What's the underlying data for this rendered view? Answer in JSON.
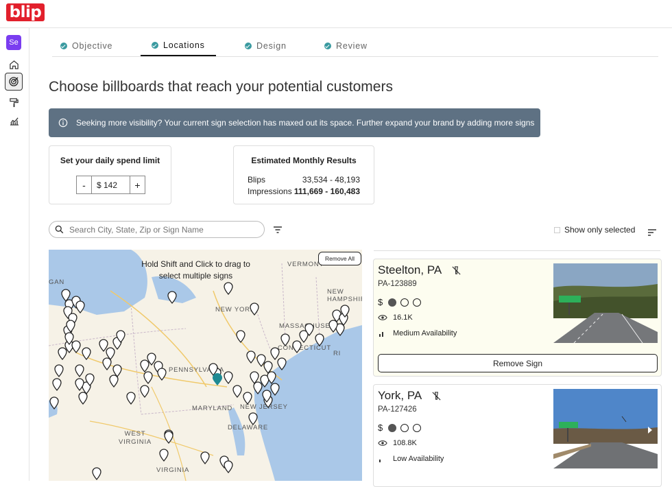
{
  "app": {
    "logo_text": "blip",
    "avatar_initials": "Se",
    "brand_color": "#e2202c"
  },
  "nav": [
    {
      "name": "home-icon"
    },
    {
      "name": "target-icon",
      "active": true
    },
    {
      "name": "paint-roller-icon"
    },
    {
      "name": "analytics-icon"
    }
  ],
  "tabs": [
    {
      "label": "Objective",
      "done": true
    },
    {
      "label": "Locations",
      "done": true,
      "active": true
    },
    {
      "label": "Design",
      "done": true
    },
    {
      "label": "Review",
      "done": true
    }
  ],
  "page_title": "Choose billboards that reach your potential customers",
  "info_banner": "Seeking more visibility? Your current sign selection has maxed out its space. Further expand your brand by adding more signs",
  "spend": {
    "title": "Set your daily spend limit",
    "minus": "-",
    "plus": "+",
    "value": "$ 142"
  },
  "results": {
    "title": "Estimated Monthly Results",
    "blips_label": "Blips",
    "blips_value": "33,534 - 48,193",
    "impressions_label": "Impressions",
    "impressions_value": "111,669 - 160,483"
  },
  "search": {
    "placeholder": "Search City, State, Zip or Sign Name"
  },
  "show_only_selected": "Show only selected",
  "map": {
    "hint": "Hold Shift and Click to drag to select multiple signs",
    "remove_all": "Remove All",
    "labels": {
      "vermont": "VERMONT",
      "new_york": "NEW YORK",
      "new_hampshire": "NEW HAMPSHIRE",
      "massachusetts": "MASSACHUSETTS",
      "connecticut": "CONNECTICUT",
      "ri": "RI",
      "pennsylvania": "PENNSYLVANIA",
      "maryland": "MARYLAND",
      "new_jersey": "NEW JERSEY",
      "delaware": "DELAWARE",
      "west_virginia": "WEST VIRGINIA",
      "virginia": "VIRGINIA",
      "michigan_fragment": "GAN"
    }
  },
  "signs": [
    {
      "city": "Steelton, PA",
      "id": "PA-123889",
      "price_level": 1,
      "impressions": "16.1K",
      "availability": "Medium Availability",
      "action": "Remove Sign",
      "selected": true
    },
    {
      "city": "York, PA",
      "id": "PA-127426",
      "price_level": 1,
      "impressions": "108.8K",
      "availability": "Low Availability",
      "selected": false
    }
  ],
  "price_symbol": "$"
}
